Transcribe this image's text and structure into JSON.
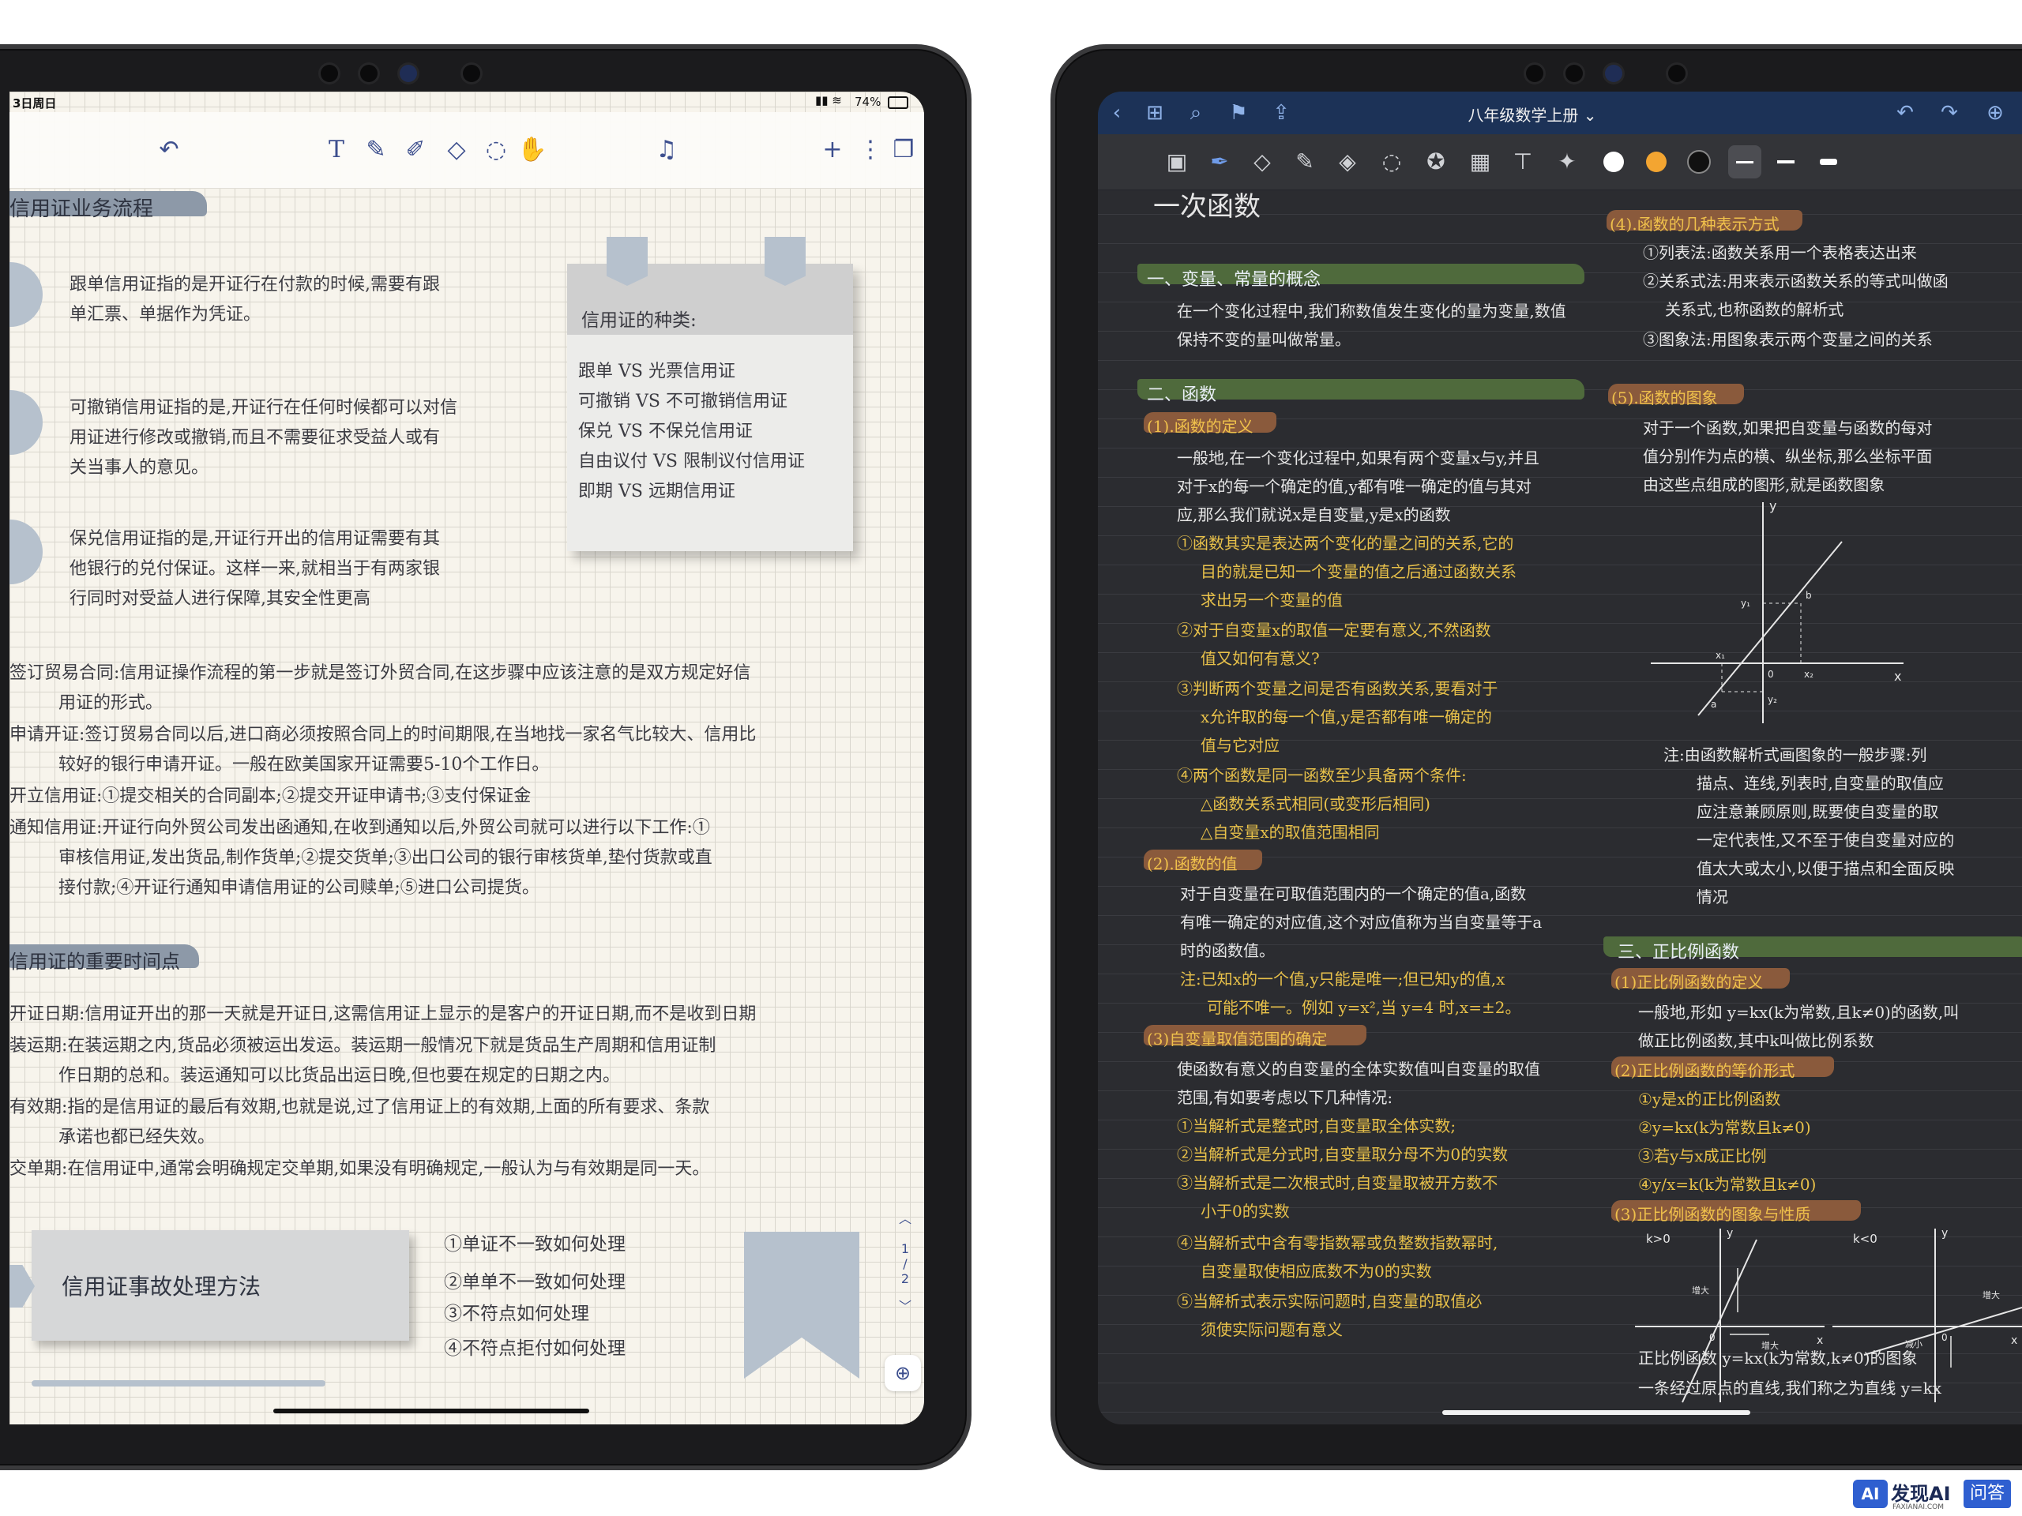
{
  "left_ipad": {
    "status": {
      "date": "3日周日",
      "battery": "74%"
    },
    "toolbar_icons": [
      "undo-icon",
      "text-icon",
      "pen-icon",
      "marker-icon",
      "eraser-icon",
      "lasso-icon",
      "hand-icon",
      "mic-icon",
      "add-icon",
      "more-icon",
      "pages-icon"
    ],
    "sections": {
      "process_title": "信用证业务流程",
      "p1": [
        "跟单信用证指的是开证行在付款的时候,需要有跟",
        "单汇票、单据作为凭证。"
      ],
      "p2": [
        "可撤销信用证指的是,开证行在任何时候都可以对信",
        "用证进行修改或撤销,而且不需要征求受益人或有",
        "关当事人的意见。"
      ],
      "p3": [
        "保兑信用证指的是,开证行开出的信用证需要有其",
        "他银行的兑付保证。这样一来,就相当于有两家银",
        "行同时对受益人进行保障,其安全性更高"
      ],
      "sticky_title": "信用证的种类:",
      "sticky_lines": [
        "跟单 VS 光票信用证",
        "可撤销 VS 不可撤销信用证",
        "保兑 VS 不保兑信用证",
        "自由议付 VS 限制议付信用证",
        "即期 VS 远期信用证"
      ],
      "steps": [
        "签订贸易合同:信用证操作流程的第一步就是签订外贸合同,在这步骤中应该注意的是双方规定好信",
        "用证的形式。",
        "申请开证:签订贸易合同以后,进口商必须按照合同上的时间期限,在当地找一家名气比较大、信用比",
        "较好的银行申请开证。一般在欧美国家开证需要5-10个工作日。",
        "开立信用证:①提交相关的合同副本;②提交开证申请书;③支付保证金",
        "通知信用证:开证行向外贸公司发出函通知,在收到通知以后,外贸公司就可以进行以下工作:①",
        "审核信用证,发出货品,制作货单;②提交货单;③出口公司的银行审核货单,垫付货款或直",
        "接付款;④开证行通知申请信用证的公司赎单;⑤进口公司提货。"
      ],
      "dates_title": "信用证的重要时间点",
      "dates": [
        "开证日期:信用证开出的那一天就是开证日,这需信用证上显示的是客户的开证日期,而不是收到日期",
        "装运期:在装运期之内,货品必须被运出发运。装运期一般情况下就是货品生产周期和信用证制",
        "作日期的总和。装运通知可以比货品出运日晚,但也要在规定的日期之内。",
        "有效期:指的是信用证的最后有效期,也就是说,过了信用证上的有效期,上面的所有要求、条款",
        "承诺也都已经失效。",
        "交单期:在信用证中,通常会明确规定交单期,如果没有明确规定,一般认为与有效期是同一天。"
      ],
      "accident_title": "信用证事故处理方法",
      "accident_items": [
        "①单证不一致如何处理",
        "②单单不一致如何处理",
        "③不符点如何处理",
        "④不符点拒付如何处理"
      ]
    },
    "page_indicator": {
      "current": "1",
      "sep": "/",
      "total": "2"
    }
  },
  "right_ipad": {
    "nav": {
      "title": "八年级数学上册 ⌄"
    },
    "toolbar_icons": [
      "pages-icon",
      "pen-icon",
      "eraser-icon",
      "highlighter-icon",
      "shapes-icon",
      "lasso-icon",
      "sticker-icon",
      "image-icon",
      "textbox-icon",
      "laser-icon"
    ],
    "colors": {
      "white": "#ffffff",
      "orange": "#f3a531",
      "black": "#111111",
      "nav_bg": "#1c3257",
      "screen_bg": "#2b2c30",
      "highlight_green": "#4f6a3c",
      "highlight_brown": "#8a5a3c",
      "ink_yellow": "#e8c14a"
    },
    "page_title": "一次函数",
    "left_col": {
      "h1": "一、变量、常量的概念",
      "h1_text": [
        "在一个变化过程中,我们称数值发生变化的量为变量,数值",
        "保持不变的量叫做常量。"
      ],
      "h2": "二、函数",
      "h2_1": "(1).函数的定义",
      "h2_1_text": [
        "一般地,在一个变化过程中,如果有两个变量x与y,并且",
        "对于x的每一个确定的值,y都有唯一确定的值与其对",
        "应,那么我们就说x是自变量,y是x的函数"
      ],
      "h2_1_notes": [
        "①函数其实是表达两个变化的量之间的关系,它的",
        "目的就是已知一个变量的值之后通过函数关系",
        "求出另一个变量的值",
        "②对于自变量x的取值一定要有意义,不然函数",
        "值又如何有意义?",
        "③判断两个变量之间是否有函数关系,要看对于",
        "x允许取的每一个值,y是否都有唯一确定的",
        "值与它对应",
        "④两个函数是同一函数至少具备两个条件:",
        "△函数关系式相同(或变形后相同)",
        "△自变量x的取值范围相同"
      ],
      "h2_2": "(2).函数的值",
      "h2_2_text": [
        "对于自变量在可取值范围内的一个确定的值a,函数",
        "有唯一确定的对应值,这个对应值称为当自变量等于a",
        "时的函数值。"
      ],
      "h2_2_note": [
        "注:已知x的一个值,y只能是唯一;但已知y的值,x",
        "可能不唯一。例如 y=x²,当 y=4 时,x=±2。"
      ],
      "h2_3": "(3)自变量取值范围的确定",
      "h2_3_text": [
        "使函数有意义的自变量的全体实数值叫自变量的取值",
        "范围,有如要考虑以下几种情况:"
      ],
      "h2_3_notes": [
        "①当解析式是整式时,自变量取全体实数;",
        "②当解析式是分式时,自变量取分母不为0的实数",
        "③当解析式是二次根式时,自变量取被开方数不",
        "小于0的实数",
        "④当解析式中含有零指数幂或负整数指数幂时,",
        "自变量取使相应底数不为0的实数",
        "⑤当解析式表示实际问题时,自变量的取值必",
        "须使实际问题有意义"
      ]
    },
    "right_col": {
      "r4": "(4).函数的几种表示方式",
      "r4_text": [
        "①列表法:函数关系用一个表格表达出来",
        "②关系式法:用来表示函数关系的等式叫做函",
        "关系式,也称函数的解析式",
        "③图象法:用图象表示两个变量之间的关系"
      ],
      "r5": "(5).函数的图象",
      "r5_text": [
        "对于一个函数,如果把自变量与函数的每对",
        "值分别作为点的横、纵坐标,那么坐标平面",
        "由这些点组成的图形,就是函数图象"
      ],
      "graph1_labels": [
        "y",
        "x",
        "0",
        "y₁",
        "y₂",
        "x₁",
        "x₂",
        "a",
        "b"
      ],
      "r5_note": [
        "注:由函数解析式画图象的一般步骤:列",
        "描点、连线,列表时,自变量的取值应",
        "应注意兼顾原则,既要使自变量的取",
        "一定代表性,又不至于使自变量对应的",
        "值太大或太小,以便于描点和全面反映",
        "情况"
      ],
      "r3": "三、正比例函数",
      "r3_1": "(1)正比例函数的定义",
      "r3_1_text": [
        "一般地,形如 y=kx(k为常数,且k≠0)的函数,叫",
        "做正比例函数,其中k叫做比例系数"
      ],
      "r3_2": "(2)正比例函数的等价形式",
      "r3_2_text": [
        "①y是x的正比例函数",
        "②y=kx(k为常数且k≠0)",
        "③若y与x成正比例",
        "④y/x=k(k为常数且k≠0)"
      ],
      "r3_3": "(3)正比例函数的图象与性质",
      "graph2_labels": [
        "k>0",
        "y",
        "x",
        "0",
        "增大",
        "增大"
      ],
      "graph3_labels": [
        "k<0",
        "y",
        "x",
        "0",
        "增大",
        "减小"
      ],
      "r3_3_text": [
        "正比例函数 y=kx(k为常数,k≠0)的图象",
        "一条经过原点的直线,我们称之为直线 y=kx"
      ]
    }
  },
  "watermark": {
    "brand": "发现AI",
    "sub": "FAXIANAI.COM",
    "tag": "问答"
  }
}
